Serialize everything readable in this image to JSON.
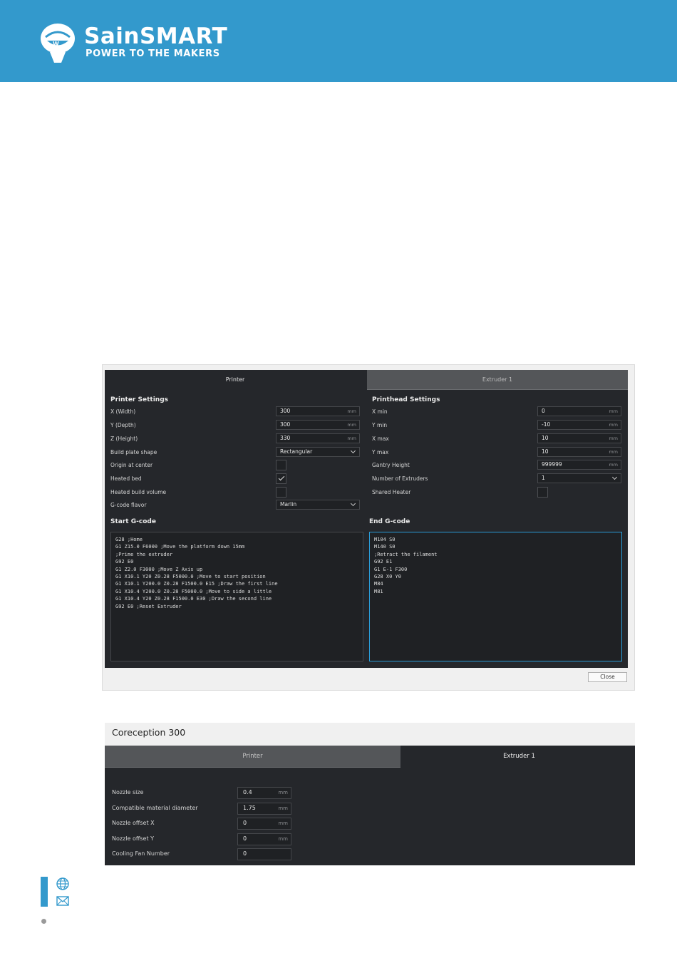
{
  "brand": {
    "name": "SainSMART",
    "tagline": "POWER TO THE MAKERS",
    "color": "#3399cc"
  },
  "machine_settings": {
    "tabs": [
      {
        "label": "Printer",
        "active": true
      },
      {
        "label": "Extruder 1",
        "active": false
      }
    ],
    "printer_settings": {
      "title": "Printer Settings",
      "rows": [
        {
          "label": "X (Width)",
          "value": "300",
          "unit": "mm"
        },
        {
          "label": "Y (Depth)",
          "value": "300",
          "unit": "mm"
        },
        {
          "label": "Z (Height)",
          "value": "330",
          "unit": "mm"
        },
        {
          "label": "Build plate shape",
          "value": "Rectangular"
        },
        {
          "label": "Origin at center",
          "checked": false
        },
        {
          "label": "Heated bed",
          "checked": true
        },
        {
          "label": "Heated build volume",
          "checked": false
        },
        {
          "label": "G-code flavor",
          "value": "Marlin"
        }
      ]
    },
    "printhead_settings": {
      "title": "Printhead Settings",
      "rows": [
        {
          "label": "X min",
          "value": "0",
          "unit": "mm"
        },
        {
          "label": "Y min",
          "value": "-10",
          "unit": "mm"
        },
        {
          "label": "X max",
          "value": "10",
          "unit": "mm"
        },
        {
          "label": "Y max",
          "value": "10",
          "unit": "mm"
        },
        {
          "label": "Gantry Height",
          "value": "999999",
          "unit": "mm"
        },
        {
          "label": "Number of Extruders",
          "value": "1"
        },
        {
          "label": "Shared Heater",
          "checked": false
        }
      ]
    },
    "start_gcode": {
      "title": "Start G-code",
      "text": "G28 ;Home\nG1 Z15.0 F6000 ;Move the platform down 15mm\n;Prime the extruder\nG92 E0\nG1 Z2.0 F3000 ;Move Z Axis up\nG1 X10.1 Y20 Z0.28 F5000.0 ;Move to start position\nG1 X10.1 Y200.0 Z0.28 F1500.0 E15 ;Draw the first line\nG1 X10.4 Y200.0 Z0.28 F5000.0 ;Move to side a little\nG1 X10.4 Y20 Z0.28 F1500.0 E30 ;Draw the second line\nG92 E0 ;Reset Extruder"
    },
    "end_gcode": {
      "title": "End G-code",
      "text": "M104 S0\nM140 S0\n;Retract the filament\nG92 E1\nG1 E-1 F300\nG28 X0 Y0\nM84\nM81"
    },
    "close_label": "Close"
  },
  "extruder_settings": {
    "title": "Coreception 300",
    "tabs": [
      {
        "label": "Printer",
        "active": false
      },
      {
        "label": "Extruder 1",
        "active": true
      }
    ],
    "rows": [
      {
        "label": "Nozzle size",
        "value": "0.4",
        "unit": "mm"
      },
      {
        "label": "Compatible material diameter",
        "value": "1.75",
        "unit": "mm"
      },
      {
        "label": "Nozzle offset X",
        "value": "0",
        "unit": "mm"
      },
      {
        "label": "Nozzle offset Y",
        "value": "0",
        "unit": "mm"
      },
      {
        "label": "Cooling Fan Number",
        "value": "0",
        "unit": ""
      }
    ]
  },
  "footer": {
    "icons": [
      "globe-icon",
      "mail-icon"
    ]
  }
}
